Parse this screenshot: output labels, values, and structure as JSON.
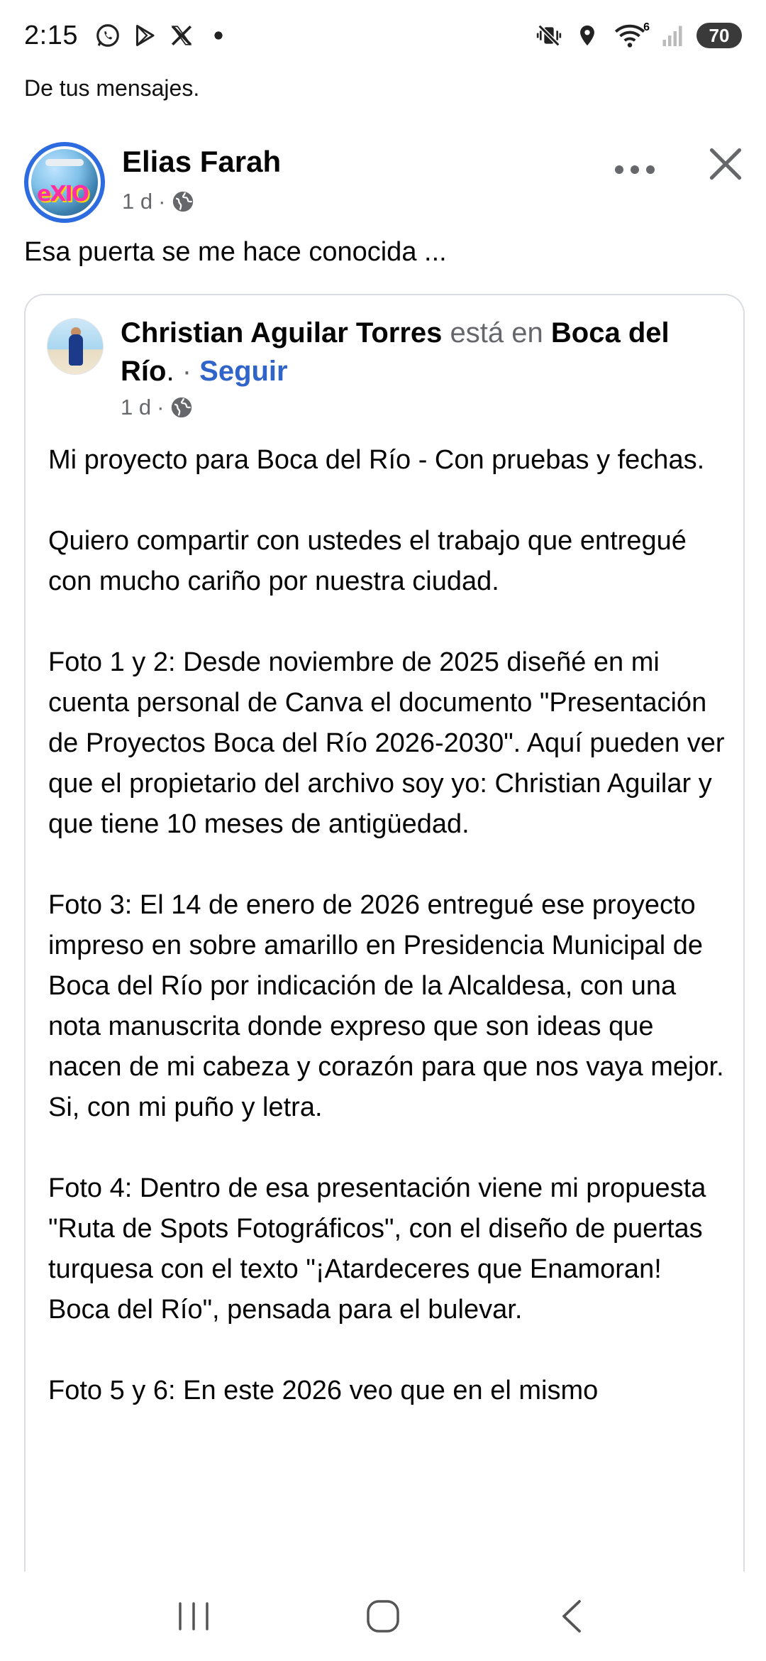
{
  "status_bar": {
    "time": "2:15",
    "left_icons": [
      "whatsapp-icon",
      "play-store-icon",
      "x-icon",
      "dot-icon"
    ],
    "right_icons": [
      "vibrate-mute-icon",
      "location-icon",
      "wifi-icon",
      "signal-icon"
    ],
    "wifi_label": "6",
    "battery": "70"
  },
  "notice": "De tus mensajes.",
  "post": {
    "author": "Elias Farah",
    "time": "1 d",
    "separator": "·",
    "text": "Esa puerta se me hace conocida ..."
  },
  "shared_post": {
    "author": "Christian Aguilar Torres",
    "is_at": "está en",
    "place": "Boca del Río",
    "place_suffix": ".",
    "separator": "·",
    "follow": "Seguir",
    "time": "1 d",
    "paragraphs": [
      "Mi proyecto para Boca del Río - Con pruebas y fechas.",
      "Quiero compartir con ustedes el trabajo que entregué con mucho cariño por nuestra ciudad.",
      "Foto 1 y 2: Desde noviembre de 2025 diseñé en mi cuenta personal de Canva el documento \"Presentación de Proyectos Boca del Río 2026-2030\". Aquí pueden ver que el propietario del archivo soy yo: Christian Aguilar y que tiene 10 meses de antigüedad.",
      "Foto 3: El 14 de enero de 2026 entregué ese proyecto impreso en sobre amarillo en Presidencia Municipal de Boca del Río por indicación de la Alcaldesa, con una nota manuscrita donde expreso que son ideas que nacen de mi cabeza y corazón para que nos vaya mejor. Si, con mi puño y letra.",
      "Foto 4: Dentro de esa presentación viene mi propuesta \"Ruta de Spots Fotográficos\", con el diseño de puertas turquesa con el texto \"¡Atardeceres que Enamoran! Boca del Río\", pensada para el bulevar.",
      "Foto 5 y 6: En este 2026 veo que en el mismo"
    ]
  },
  "colors": {
    "link_blue": "#3064c9",
    "avatar_ring": "#2d6be0",
    "meta_grey": "#65676b",
    "battery_bg": "#3a3a3a"
  },
  "nav_bar": {
    "icons": [
      "recent-apps-icon",
      "home-icon",
      "back-icon"
    ]
  }
}
